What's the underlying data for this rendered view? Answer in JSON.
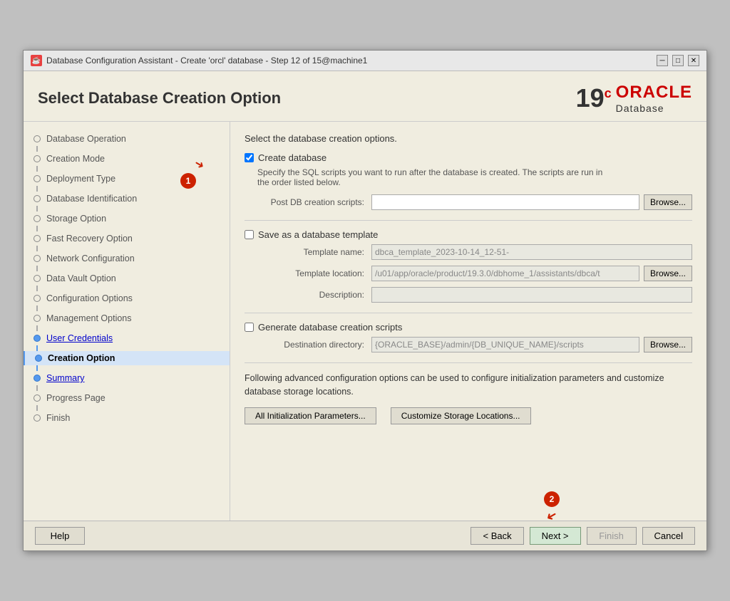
{
  "window": {
    "title": "Database Configuration Assistant - Create 'orcl' database - Step 12 of 15@machine1",
    "icon": "☕"
  },
  "header": {
    "title": "Select Database Creation Option",
    "oracle_version": "19",
    "oracle_sup": "c",
    "oracle_brand": "ORACLE",
    "oracle_db": "Database"
  },
  "sidebar": {
    "items": [
      {
        "label": "Database Operation",
        "state": "normal",
        "id": "database-operation"
      },
      {
        "label": "Creation Mode",
        "state": "normal",
        "id": "creation-mode"
      },
      {
        "label": "Deployment Type",
        "state": "normal",
        "id": "deployment-type"
      },
      {
        "label": "Database Identification",
        "state": "normal",
        "id": "database-identification"
      },
      {
        "label": "Storage Option",
        "state": "normal",
        "id": "storage-option"
      },
      {
        "label": "Fast Recovery Option",
        "state": "normal",
        "id": "fast-recovery-option"
      },
      {
        "label": "Network Configuration",
        "state": "normal",
        "id": "network-configuration"
      },
      {
        "label": "Data Vault Option",
        "state": "normal",
        "id": "data-vault-option"
      },
      {
        "label": "Configuration Options",
        "state": "normal",
        "id": "configuration-options"
      },
      {
        "label": "Management Options",
        "state": "normal",
        "id": "management-options"
      },
      {
        "label": "User Credentials",
        "state": "link",
        "id": "user-credentials"
      },
      {
        "label": "Creation Option",
        "state": "active",
        "id": "creation-option"
      },
      {
        "label": "Summary",
        "state": "link",
        "id": "summary"
      },
      {
        "label": "Progress Page",
        "state": "normal",
        "id": "progress-page"
      },
      {
        "label": "Finish",
        "state": "normal",
        "id": "finish"
      }
    ]
  },
  "main": {
    "description": "Select the database creation options.",
    "create_database": {
      "label": "Create database",
      "checked": true,
      "sub_desc": "Specify the SQL scripts you want to run after the database is created. The scripts are run in\nthe order listed below.",
      "post_db_label": "Post DB creation scripts:",
      "post_db_value": "",
      "browse_label": "Browse..."
    },
    "save_template": {
      "label": "Save as a database template",
      "checked": false,
      "template_name_label": "Template name:",
      "template_name_value": "dbca_template_2023-10-14_12-51-",
      "template_location_label": "Template location:",
      "template_location_value": "/u01/app/oracle/product/19.3.0/dbhome_1/assistants/dbca/t",
      "template_location_browse": "Browse...",
      "description_label": "Description:",
      "description_value": ""
    },
    "generate_scripts": {
      "label": "Generate database creation scripts",
      "checked": false,
      "dest_dir_label": "Destination directory:",
      "dest_dir_value": "{ORACLE_BASE}/admin/{DB_UNIQUE_NAME}/scripts",
      "dest_dir_browse": "Browse..."
    },
    "advanced_text": "Following advanced configuration options can be used to configure initialization parameters and\ncustomize database storage locations.",
    "btn_all_init": "All Initialization Parameters...",
    "btn_customize": "Customize Storage Locations..."
  },
  "footer": {
    "help_label": "Help",
    "back_label": "< Back",
    "next_label": "Next >",
    "finish_label": "Finish",
    "cancel_label": "Cancel"
  },
  "annotations": {
    "circle1": "1",
    "circle2": "2"
  }
}
